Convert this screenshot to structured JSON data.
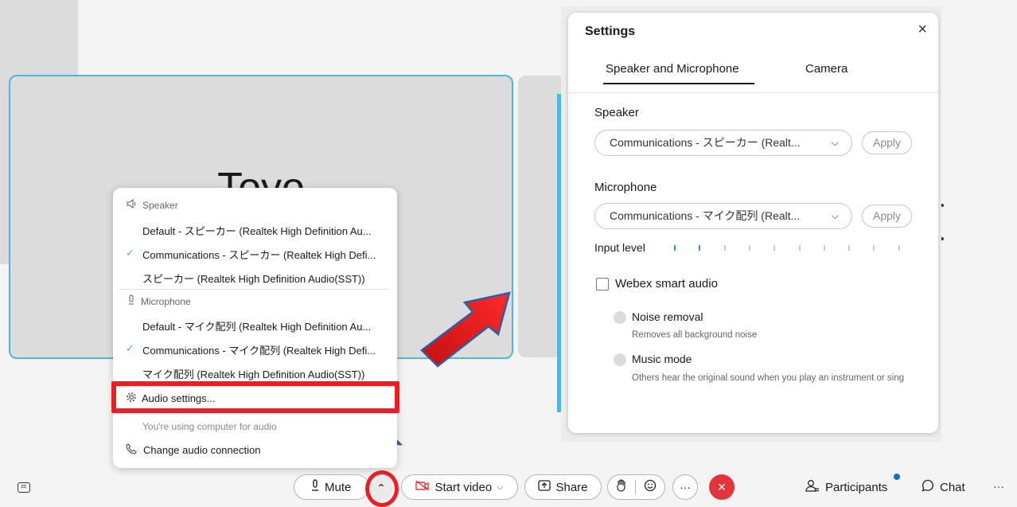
{
  "video": {
    "participant_name": "Toyo"
  },
  "audio_menu": {
    "speaker_heading": "Speaker",
    "speakers": [
      {
        "label": "Default - スピーカー (Realtek High Definition Au...",
        "checked": false
      },
      {
        "label": "Communications - スピーカー (Realtek High Defi...",
        "checked": true
      },
      {
        "label": "スピーカー (Realtek High Definition Audio(SST))",
        "checked": false
      }
    ],
    "microphone_heading": "Microphone",
    "microphones": [
      {
        "label": "Default - マイク配列 (Realtek High Definition Au...",
        "checked": false
      },
      {
        "label": "Communications - マイク配列 (Realtek High Defi...",
        "checked": true
      },
      {
        "label": "マイク配列 (Realtek High Definition Audio(SST))",
        "checked": false
      }
    ],
    "audio_settings": "Audio settings...",
    "status": "You're using computer for audio",
    "change_connection": "Change audio connection"
  },
  "settings": {
    "title": "Settings",
    "tabs": [
      "Speaker and Microphone",
      "Camera"
    ],
    "speaker_label": "Speaker",
    "speaker_value": "Communications - スピーカー (Realt...",
    "microphone_label": "Microphone",
    "microphone_value": "Communications - マイク配列 (Realt...",
    "apply_label": "Apply",
    "input_level_label": "Input level",
    "input_level_active_ticks": 2,
    "smart_audio_label": "Webex smart audio",
    "noise_removal_label": "Noise removal",
    "noise_removal_desc": "Removes all background noise",
    "music_mode_label": "Music mode",
    "music_mode_desc": "Others hear the original sound when you play an instrument or sing"
  },
  "toolbar": {
    "mute_label": "Mute",
    "start_video_label": "Start video",
    "share_label": "Share",
    "participants_label": "Participants",
    "chat_label": "Chat"
  },
  "colors": {
    "accent_blue": "#4fb6e0",
    "annotation_red": "#ee1d23",
    "end_call_red": "#e5333a"
  }
}
